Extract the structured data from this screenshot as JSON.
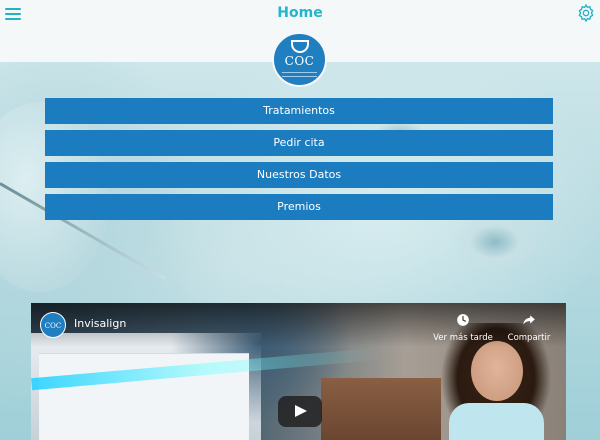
{
  "header": {
    "title": "Home",
    "menu_icon": "hamburger-menu-icon",
    "settings_icon": "gear-icon"
  },
  "logo": {
    "text": "COC"
  },
  "nav": {
    "items": [
      {
        "label": "Tratamientos"
      },
      {
        "label": "Pedir cita"
      },
      {
        "label": "Nuestros Datos"
      },
      {
        "label": "Premios"
      }
    ]
  },
  "video": {
    "title": "Invisalign",
    "channel_avatar_text": "COC",
    "watch_later_label": "Ver más tarde",
    "share_label": "Compartir",
    "watch_later_icon": "clock-icon",
    "share_icon": "share-arrow-icon",
    "play_icon": "play-icon"
  },
  "colors": {
    "accent": "#23b6cb",
    "button_blue": "#1b7dc0",
    "logo_blue": "#1f7fc0"
  }
}
